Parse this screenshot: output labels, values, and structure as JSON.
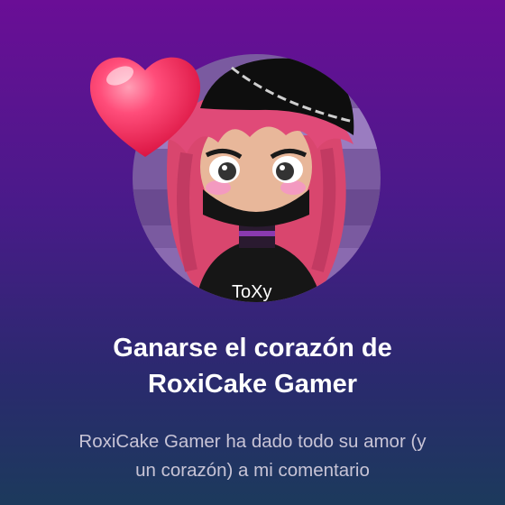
{
  "notification": {
    "title_line1": "Ganarse el corazón de",
    "title_line2": "RoxiCake Gamer",
    "message_line1": "RoxiCake Gamer ha dado todo su amor (y",
    "message_line2": "un corazón) a mi comentario",
    "avatar_shirt_text": "ToXy"
  },
  "icons": {
    "heart": "heart-icon",
    "avatar": "user-avatar"
  },
  "colors": {
    "background_top": "#6a0e96",
    "background_bottom": "#1c3a5c",
    "heart": "#f0245a",
    "title": "#ffffff",
    "message": "#c8c4d6"
  }
}
